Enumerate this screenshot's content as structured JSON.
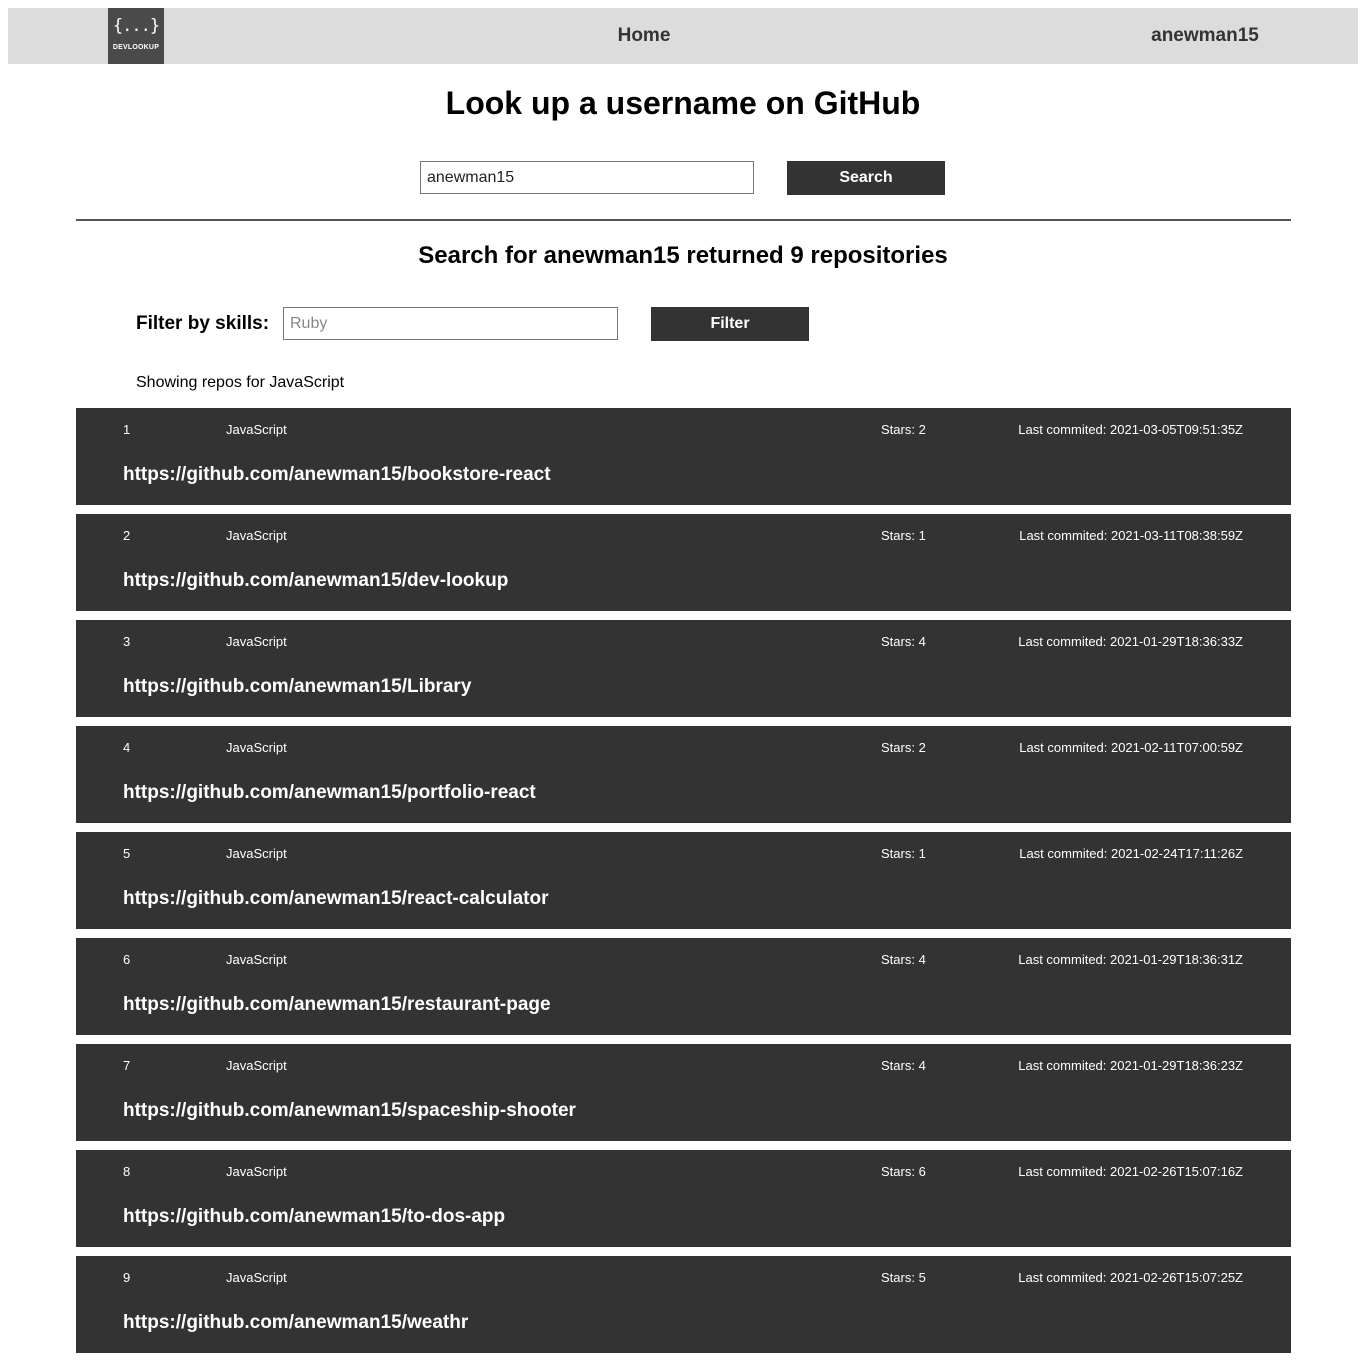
{
  "navbar": {
    "logo_text": "DEVLOOKUP",
    "logo_glyph": "{...}",
    "home_label": "Home",
    "user_label": "anewman15"
  },
  "search": {
    "title": "Look up a username on GitHub",
    "input_value": "anewman15",
    "button_label": "Search"
  },
  "results": {
    "heading": "Search for anewman15 returned 9 repositories",
    "filter_label": "Filter by skills:",
    "filter_placeholder": "Ruby",
    "filter_button_label": "Filter",
    "showing_text": "Showing repos for JavaScript"
  },
  "repos": [
    {
      "num": "1",
      "language": "JavaScript",
      "stars": "Stars: 2",
      "last_commit": "Last commited: 2021-03-05T09:51:35Z",
      "url": "https://github.com/anewman15/bookstore-react"
    },
    {
      "num": "2",
      "language": "JavaScript",
      "stars": "Stars: 1",
      "last_commit": "Last commited: 2021-03-11T08:38:59Z",
      "url": "https://github.com/anewman15/dev-lookup"
    },
    {
      "num": "3",
      "language": "JavaScript",
      "stars": "Stars: 4",
      "last_commit": "Last commited: 2021-01-29T18:36:33Z",
      "url": "https://github.com/anewman15/Library"
    },
    {
      "num": "4",
      "language": "JavaScript",
      "stars": "Stars: 2",
      "last_commit": "Last commited: 2021-02-11T07:00:59Z",
      "url": "https://github.com/anewman15/portfolio-react"
    },
    {
      "num": "5",
      "language": "JavaScript",
      "stars": "Stars: 1",
      "last_commit": "Last commited: 2021-02-24T17:11:26Z",
      "url": "https://github.com/anewman15/react-calculator"
    },
    {
      "num": "6",
      "language": "JavaScript",
      "stars": "Stars: 4",
      "last_commit": "Last commited: 2021-01-29T18:36:31Z",
      "url": "https://github.com/anewman15/restaurant-page"
    },
    {
      "num": "7",
      "language": "JavaScript",
      "stars": "Stars: 4",
      "last_commit": "Last commited: 2021-01-29T18:36:23Z",
      "url": "https://github.com/anewman15/spaceship-shooter"
    },
    {
      "num": "8",
      "language": "JavaScript",
      "stars": "Stars: 6",
      "last_commit": "Last commited: 2021-02-26T15:07:16Z",
      "url": "https://github.com/anewman15/to-dos-app"
    },
    {
      "num": "9",
      "language": "JavaScript",
      "stars": "Stars: 5",
      "last_commit": "Last commited: 2021-02-26T15:07:25Z",
      "url": "https://github.com/anewman15/weathr"
    }
  ]
}
